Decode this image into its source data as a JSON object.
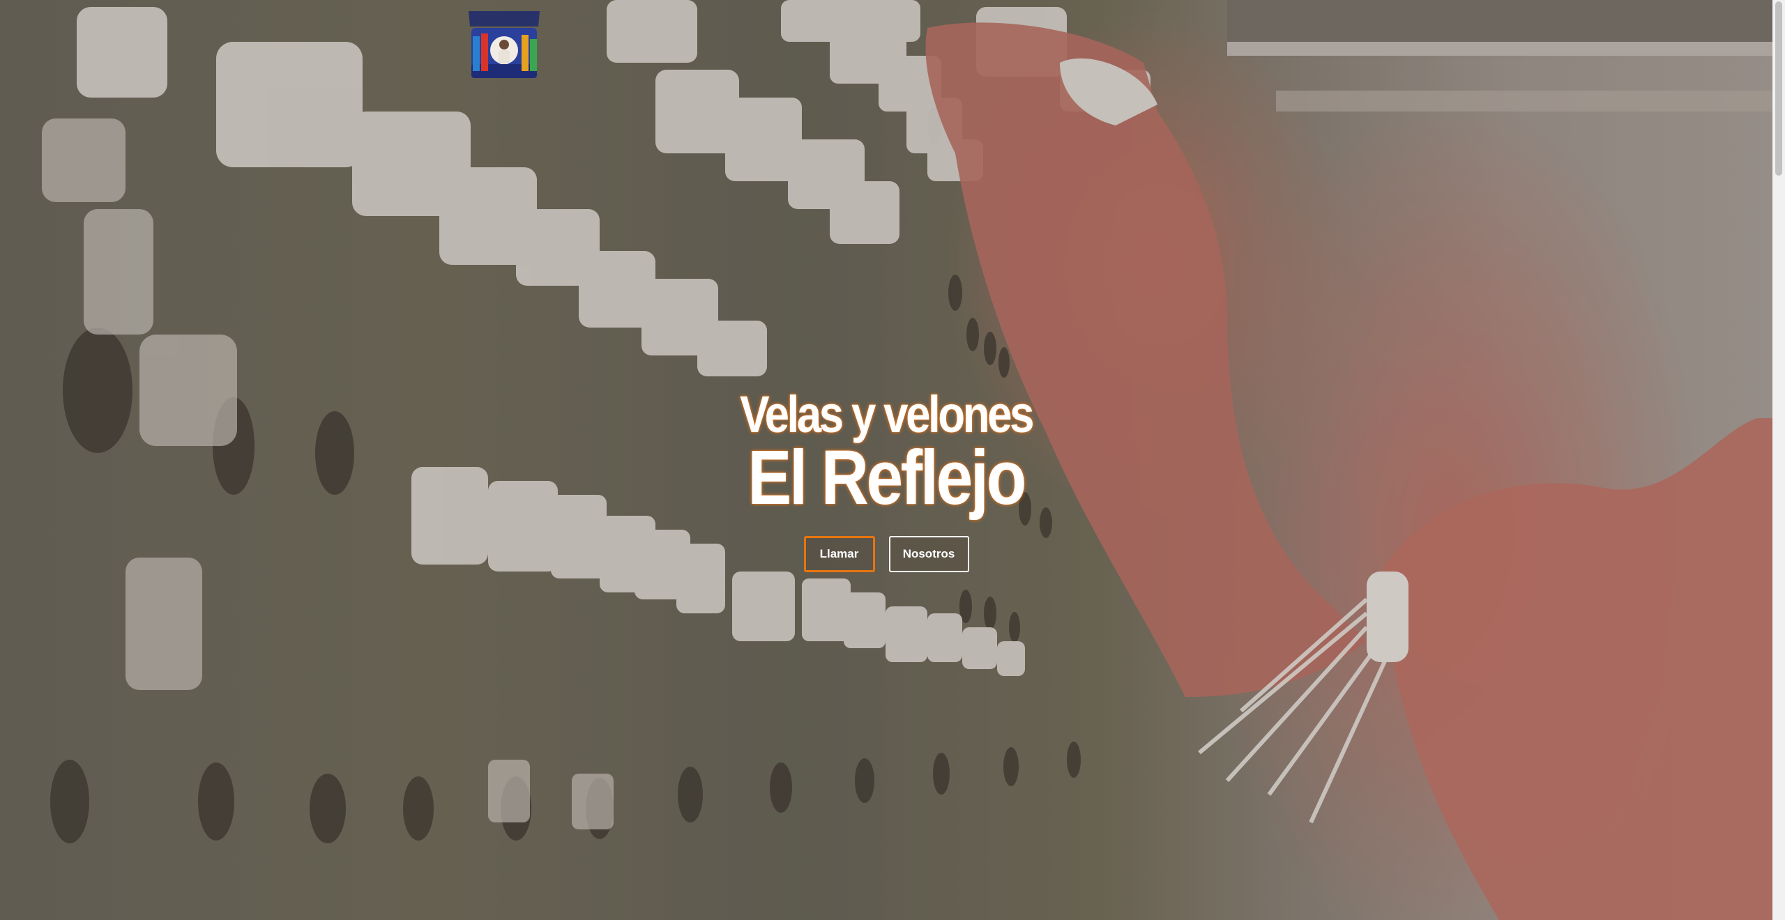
{
  "logo": {
    "text_line1": "VELAS & VELONES",
    "text_line2": "El Reflejo"
  },
  "hero": {
    "subtitle": "Velas y velones",
    "title": "El Reflejo",
    "buttons": {
      "call_label": "Llamar",
      "about_label": "Nosotros"
    }
  },
  "colors": {
    "accent": "#e7750f",
    "text": "#ffffff"
  }
}
